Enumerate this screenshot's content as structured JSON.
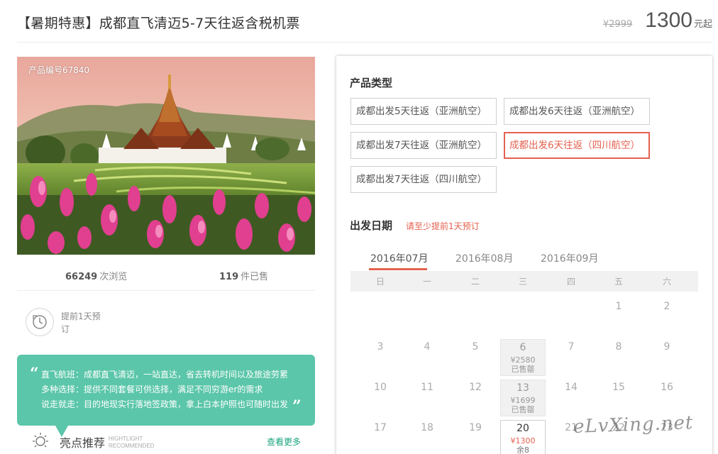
{
  "header": {
    "title": "【暑期特惠】成都直飞清迈5-7天往返含税机票",
    "old_price": "¥2999",
    "price": "1300",
    "price_suffix": "元起"
  },
  "product": {
    "number_label": "产品编号67840",
    "views_count": "66249",
    "views_label": "次浏览",
    "sold_count": "119",
    "sold_label": "件已售"
  },
  "booking_tip": "提前1天预订",
  "description": {
    "lines": [
      "直飞航班：成都直飞清迈，一站直达，省去转机时间以及旅途劳累",
      "多种选择：提供不同套餐可供选择，满足不同穷游er的需求",
      "说走就走：目的地现实行落地签政策，拿上白本护照也可随时出发"
    ]
  },
  "highlights": {
    "title": "亮点推荐",
    "en_line1": "HIGHTLIGHT",
    "en_line2": "RECOMMENDED",
    "see_more": "查看更多"
  },
  "product_type": {
    "label": "产品类型",
    "options": [
      "成都出发5天往返（亚洲航空）",
      "成都出发6天往返（亚洲航空）",
      "成都出发7天往返（亚洲航空）",
      "成都出发6天往返（四川航空）",
      "成都出发7天往返（四川航空）"
    ],
    "selected_index": 3
  },
  "departure": {
    "label": "出发日期",
    "hint": "请至少提前1天预订",
    "months": [
      "2016年07月",
      "2016年08月",
      "2016年09月"
    ],
    "active_month": 0,
    "weekdays": [
      "日",
      "一",
      "二",
      "三",
      "四",
      "五",
      "六"
    ],
    "days": [
      {
        "day": "1"
      },
      {
        "day": "2"
      },
      {
        "day": "3"
      },
      {
        "day": "4"
      },
      {
        "day": "5"
      },
      {
        "day": "6",
        "price": "¥2580",
        "status": "已售罄"
      },
      {
        "day": "7"
      },
      {
        "day": "8"
      },
      {
        "day": "9"
      },
      {
        "day": "10"
      },
      {
        "day": "11"
      },
      {
        "day": "12"
      },
      {
        "day": "13",
        "price": "¥1699",
        "status": "已售罄"
      },
      {
        "day": "14"
      },
      {
        "day": "15"
      },
      {
        "day": "16"
      },
      {
        "day": "17"
      },
      {
        "day": "18"
      },
      {
        "day": "19"
      },
      {
        "day": "20",
        "price": "¥1300",
        "status": "余8"
      },
      {
        "day": "21"
      },
      {
        "day": "22"
      },
      {
        "day": "23"
      }
    ]
  },
  "watermark": "eLvXing.net",
  "colors": {
    "accent": "#e4614f",
    "green": "#5bc6a9",
    "link_green": "#1aa47f"
  }
}
